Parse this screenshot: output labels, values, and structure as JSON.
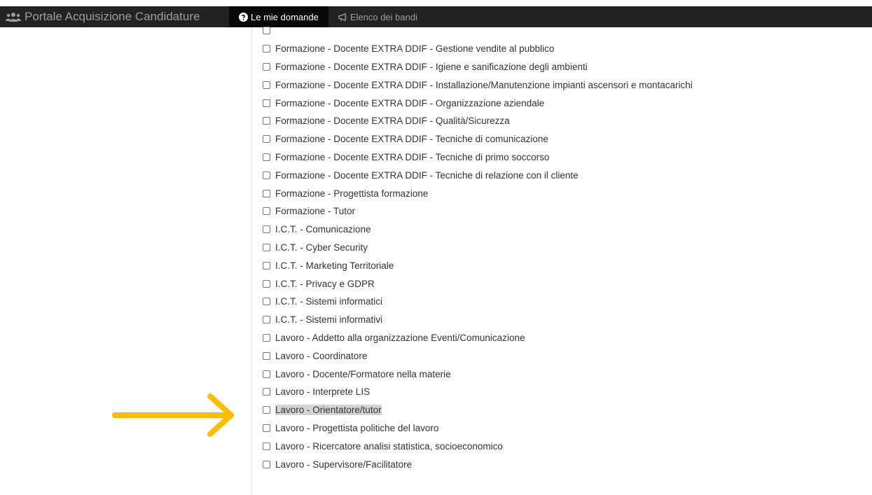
{
  "navbar": {
    "brand": "Portale Acquisizione Candidature",
    "brand_icon": "users-icon",
    "tabs": [
      {
        "label": "Le mie domande",
        "icon": "question-circle-icon",
        "active": true
      },
      {
        "label": "Elenco dei bandi",
        "icon": "bullhorn-icon",
        "active": false
      }
    ],
    "background": "#222222"
  },
  "options": [
    {
      "label": "",
      "partial": true
    },
    {
      "label": "Formazione - Docente EXTRA DDIF - Gestione vendite al pubblico"
    },
    {
      "label": "Formazione - Docente EXTRA DDIF - Igiene e sanificazione degli ambienti"
    },
    {
      "label": "Formazione - Docente EXTRA DDIF - Installazione/Manutenzione impianti ascensori e montacarichi"
    },
    {
      "label": "Formazione - Docente EXTRA DDIF - Organizzazione aziendale"
    },
    {
      "label": "Formazione - Docente EXTRA DDIF - Qualità/Sicurezza"
    },
    {
      "label": "Formazione - Docente EXTRA DDIF - Tecniche di comunicazione"
    },
    {
      "label": "Formazione - Docente EXTRA DDIF - Tecniche di primo soccorso"
    },
    {
      "label": "Formazione - Docente EXTRA DDIF - Tecniche di relazione con il cliente"
    },
    {
      "label": "Formazione - Progettista formazione"
    },
    {
      "label": "Formazione - Tutor"
    },
    {
      "label": "I.C.T. - Comunicazione"
    },
    {
      "label": "I.C.T. - Cyber Security"
    },
    {
      "label": "I.C.T. - Marketing Territoriale"
    },
    {
      "label": "I.C.T. - Privacy e GDPR"
    },
    {
      "label": "I.C.T. - Sistemi informatici"
    },
    {
      "label": "I.C.T. - Sistemi informativi"
    },
    {
      "label": "Lavoro - Addetto alla organizzazione Eventi/Comunicazione"
    },
    {
      "label": "Lavoro - Coordinatore"
    },
    {
      "label": "Lavoro - Docente/Formatore nella materie"
    },
    {
      "label": "Lavoro - Interprete LIS"
    },
    {
      "label": "Lavoro - Orientatore/tutor",
      "highlighted": true
    },
    {
      "label": "Lavoro - Progettista politiche del lavoro"
    },
    {
      "label": "Lavoro - Ricercatore analisi statistica, socioeconomico"
    },
    {
      "label": "Lavoro - Supervisore/Facilitatore"
    }
  ],
  "annotation": {
    "icon": "arrow-right-icon",
    "color": "#fbbc04"
  },
  "colors": {
    "highlight": "#d4d4d4",
    "text": "#333333"
  }
}
